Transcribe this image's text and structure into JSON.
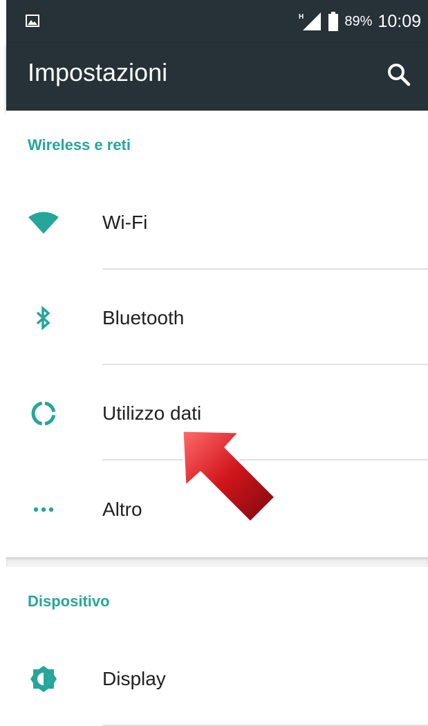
{
  "status_bar": {
    "notification_icon": "gallery-icon",
    "network_type": "H",
    "signal_icon": "signal-icon",
    "battery_icon": "battery-icon",
    "battery_percent": "89%",
    "time": "10:09"
  },
  "toolbar": {
    "title": "Impostazioni",
    "search_icon": "search-icon"
  },
  "sections": [
    {
      "header": "Wireless e reti",
      "items": [
        {
          "label": "Wi-Fi",
          "icon": "wifi-icon"
        },
        {
          "label": "Bluetooth",
          "icon": "bluetooth-icon"
        },
        {
          "label": "Utilizzo dati",
          "icon": "data-usage-icon"
        },
        {
          "label": "Altro",
          "icon": "more-icon"
        }
      ]
    },
    {
      "header": "Dispositivo",
      "items": [
        {
          "label": "Display",
          "icon": "brightness-icon"
        }
      ]
    }
  ],
  "annotation": {
    "icon": "red-arrow-icon",
    "color": "#c0131b"
  },
  "colors": {
    "toolbar_bg": "#263238",
    "accent": "#26a69a",
    "text_primary": "#212121"
  }
}
